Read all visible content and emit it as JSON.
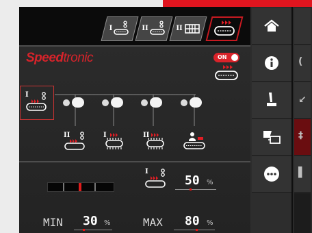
{
  "tabs": [
    {
      "roman": "I",
      "icon": "single-belt-sensor-icon"
    },
    {
      "roman": "II",
      "icon": "single-belt-sensor-icon"
    },
    {
      "roman": "II",
      "icon": "dual-belt-icon"
    },
    {
      "roman": "",
      "icon": "belt-arrows-icon",
      "active": true
    }
  ],
  "brand": {
    "logo_bold": "Speed",
    "logo_light": "tronic"
  },
  "toggle": {
    "label": "ON",
    "state": "on"
  },
  "chain": {
    "selected_roman": "I",
    "items": [
      {
        "roman": "II",
        "icon": "belt-sensor-arrows-icon"
      },
      {
        "roman": "I",
        "icon": "spiked-belt-arrows-icon"
      },
      {
        "roman": "II",
        "icon": "spiked-belt-arrows-icon"
      },
      {
        "roman": "",
        "icon": "operator-belt-icon"
      }
    ]
  },
  "speed": {
    "roman": "I",
    "value": "50",
    "unit": "%"
  },
  "limits": {
    "min_label": "MIN",
    "min_value": "30",
    "min_unit": "%",
    "max_label": "MAX",
    "max_value": "80",
    "max_unit": "%"
  },
  "slider_level": 0.5,
  "sidebar": {
    "items": [
      "home-icon",
      "info-icon",
      "joystick-icon",
      "screen-switch-icon",
      "more-icon"
    ]
  },
  "accent": "#e1151f"
}
